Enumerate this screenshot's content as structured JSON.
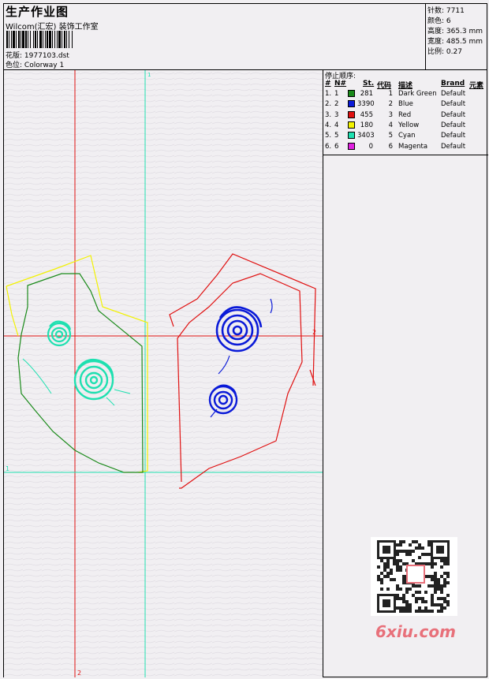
{
  "header": {
    "title": "生产作业图",
    "company": "Wilcom(汇宏) 装饰工作室",
    "design_label": "花版:",
    "design_value": "1977103.dst",
    "colorway_label": "色位:",
    "colorway_value": "Colorway 1"
  },
  "stats": {
    "stitches": "针数: 7711",
    "colors": "颜色: 6",
    "height": "高度: 365.3 mm",
    "width": "宽度: 485.5 mm",
    "scale": "比例: 0.27"
  },
  "stop_sequence": {
    "title": "停止顺序:",
    "headers": {
      "num": "#",
      "n": "N#",
      "st": "St.",
      "code": "代码",
      "desc": "描述",
      "brand": "Brand",
      "elem": "元素"
    },
    "rows": [
      {
        "num": "1.",
        "n": "1",
        "color": "#1a8a1a",
        "st": "281",
        "code": "1",
        "desc": "Dark Green",
        "brand": "Default"
      },
      {
        "num": "2.",
        "n": "2",
        "color": "#0a1ad8",
        "st": "3390",
        "code": "2",
        "desc": "Blue",
        "brand": "Default"
      },
      {
        "num": "3.",
        "n": "3",
        "color": "#e01010",
        "st": "455",
        "code": "3",
        "desc": "Red",
        "brand": "Default"
      },
      {
        "num": "4.",
        "n": "4",
        "color": "#f2f200",
        "st": "180",
        "code": "4",
        "desc": "Yellow",
        "brand": "Default"
      },
      {
        "num": "5.",
        "n": "5",
        "color": "#1ee0b0",
        "st": "3403",
        "code": "5",
        "desc": "Cyan",
        "brand": "Default"
      },
      {
        "num": "6.",
        "n": "6",
        "color": "#e020e0",
        "st": "0",
        "code": "6",
        "desc": "Magenta",
        "brand": "Default"
      }
    ]
  },
  "guides": {
    "top_marker": "1",
    "right_marker": "2",
    "left_marker": "1",
    "bottom_marker": "2"
  },
  "watermark": "6xiu.com"
}
